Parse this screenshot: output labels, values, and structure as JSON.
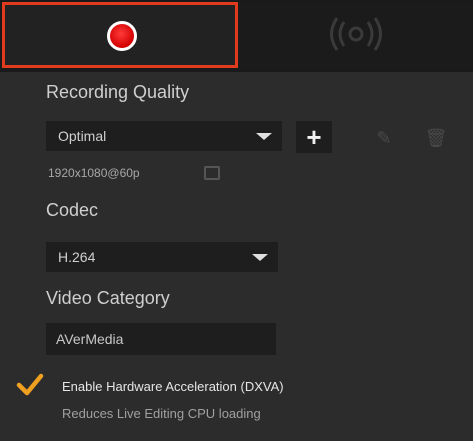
{
  "tabs": {
    "record": {
      "icon": "record-dot-icon",
      "active": true
    },
    "stream": {
      "icon": "broadcast-icon",
      "active": false
    }
  },
  "recording_quality": {
    "label": "Recording Quality",
    "selected": "Optimal",
    "resolution": "1920x1080@60p"
  },
  "codec": {
    "label": "Codec",
    "selected": "H.264"
  },
  "video_category": {
    "label": "Video Category",
    "value": "AVerMedia"
  },
  "hardware_acceleration": {
    "label": "Enable Hardware Acceleration (DXVA)",
    "description": "Reduces Live Editing CPU loading",
    "checked": true
  },
  "colors": {
    "accent": "#e23a1c",
    "record": "#d40000",
    "check": "#f0a020",
    "background": "#2c2c2c",
    "field": "#1e1e1e"
  }
}
